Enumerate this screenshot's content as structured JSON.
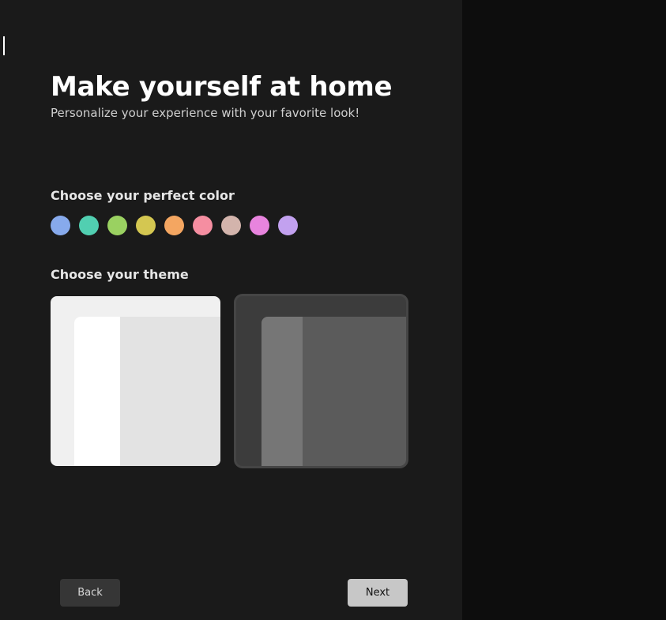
{
  "header": {
    "title": "Make yourself at home",
    "subtitle": "Personalize your experience with your favorite look!"
  },
  "color": {
    "label": "Choose your perfect color",
    "swatches": [
      {
        "name": "blue",
        "hex": "#87aaec"
      },
      {
        "name": "teal",
        "hex": "#51cfb1"
      },
      {
        "name": "green",
        "hex": "#9ad161"
      },
      {
        "name": "olive",
        "hex": "#d4c751"
      },
      {
        "name": "orange",
        "hex": "#f4a661"
      },
      {
        "name": "pink",
        "hex": "#f58ea1"
      },
      {
        "name": "mauve",
        "hex": "#d3b4ac"
      },
      {
        "name": "magenta",
        "hex": "#e884de"
      },
      {
        "name": "purple",
        "hex": "#c2a1ef"
      }
    ]
  },
  "theme": {
    "label": "Choose your theme",
    "options": [
      {
        "id": "light",
        "selected": false
      },
      {
        "id": "dark",
        "selected": true
      }
    ]
  },
  "footer": {
    "back": "Back",
    "next": "Next"
  }
}
